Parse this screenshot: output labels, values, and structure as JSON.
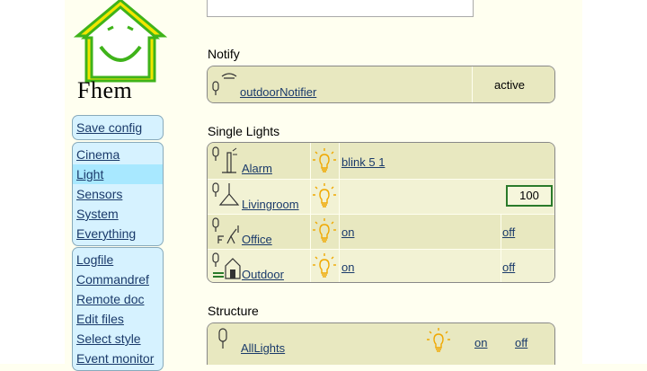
{
  "logo": {
    "text": "Fhem"
  },
  "menu": {
    "group1": [
      "Save config"
    ],
    "group2": [
      "Cinema",
      "Light",
      "Sensors",
      "System",
      "Everything"
    ],
    "group3": [
      "Logfile",
      "Commandref",
      "Remote doc",
      "Edit files",
      "Select style",
      "Event monitor"
    ],
    "selected": "Light"
  },
  "notify": {
    "title": "Notify",
    "device": "outdoorNotifier",
    "state": "active"
  },
  "single_lights": {
    "title": "Single Lights",
    "rows": [
      {
        "name": "Alarm",
        "cmd1": "blink 5 1",
        "cmd2": ""
      },
      {
        "name": "Livingroom",
        "slider_value": "100"
      },
      {
        "name": "Office",
        "cmd1": "on",
        "cmd2": "off"
      },
      {
        "name": "Outdoor",
        "cmd1": "on",
        "cmd2": "off"
      }
    ]
  },
  "structure": {
    "title": "Structure",
    "device": "AllLights",
    "cmd1": "on",
    "cmd2": "off"
  },
  "colors": {
    "menu_bg": "#d6f2ff",
    "block_bg": "#e8e8c0",
    "page_bg": "#fffff0",
    "bulb": "#f0a800",
    "logo_green": "#3fb31a",
    "logo_yellow": "#f2e600"
  }
}
